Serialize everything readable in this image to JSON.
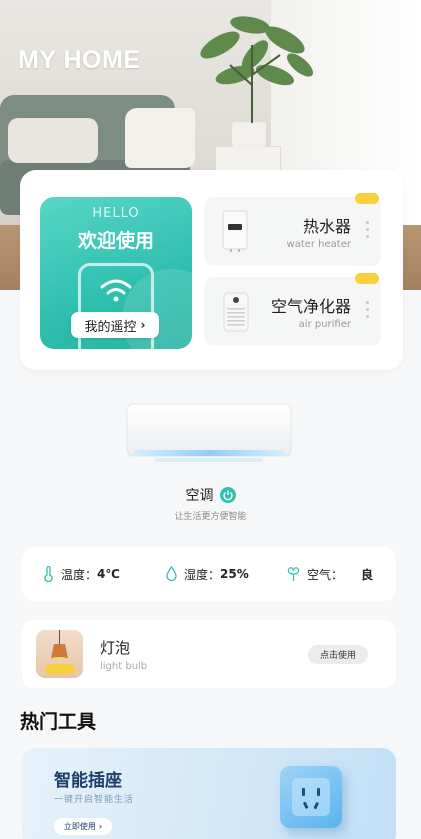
{
  "header": {
    "title": "MY HOME"
  },
  "welcome_card": {
    "hello": "HELLO",
    "title": "欢迎使用",
    "remote_button": "我的遥控"
  },
  "devices": [
    {
      "name": "热水器",
      "subtitle": "water heater",
      "icon": "water-heater-icon"
    },
    {
      "name": "空气净化器",
      "subtitle": "air purifier",
      "icon": "air-purifier-icon"
    }
  ],
  "air_conditioner": {
    "name": "空调",
    "subtitle": "让生活更方便智能",
    "icon": "power-icon"
  },
  "environment": {
    "temperature": {
      "label": "温度：",
      "value": "4℃",
      "icon": "thermometer-icon"
    },
    "humidity": {
      "label": "湿度：",
      "value": "25%",
      "icon": "water-drop-icon"
    },
    "air": {
      "label": "空气：",
      "value": "良",
      "icon": "leaf-icon"
    }
  },
  "bulb": {
    "name": "灯泡",
    "subtitle": "light bulb",
    "button": "点击使用"
  },
  "section": {
    "hot_tools": "热门工具"
  },
  "socket_banner": {
    "title": "智能插座",
    "subtitle": "一键开启智能生活",
    "button": "立即使用"
  },
  "colors": {
    "accent": "#2fbfaf",
    "banner_text": "#1f3f6b",
    "tag": "#f7d13c"
  }
}
